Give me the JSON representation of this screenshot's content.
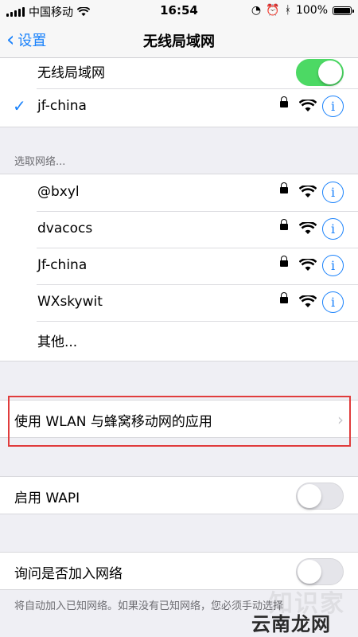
{
  "status_bar": {
    "carrier": "中国移动",
    "time": "16:54",
    "battery": "100%"
  },
  "nav": {
    "back_label": "设置",
    "title": "无线局域网"
  },
  "wlan": {
    "toggle_label": "无线局域网",
    "toggle_on": true,
    "connected_network": "jf-china"
  },
  "choose_network": {
    "header": "选取网络...",
    "networks": [
      "@bxyl",
      "dvacocs",
      "Jf-china",
      "WXskywit"
    ],
    "other_label": "其他..."
  },
  "apps_row": {
    "label": "使用 WLAN 与蜂窝移动网的应用"
  },
  "wapi": {
    "label": "启用 WAPI",
    "on": false
  },
  "ask_join": {
    "label": "询问是否加入网络",
    "on": false,
    "footer": "将自动加入已知网络。如果没有已知网络，您必须手动选择"
  },
  "watermark": {
    "main": "云南龙网",
    "faint": "知识家"
  },
  "colors": {
    "accent": "#1a82fb",
    "toggle_on": "#4cd964",
    "highlight": "#e03c3c"
  },
  "icons": {
    "back": "chevron-left-icon",
    "check": "checkmark-icon",
    "lock": "lock-icon",
    "wifi": "wifi-icon",
    "info": "info-icon",
    "disclosure": "chevron-right-icon"
  }
}
